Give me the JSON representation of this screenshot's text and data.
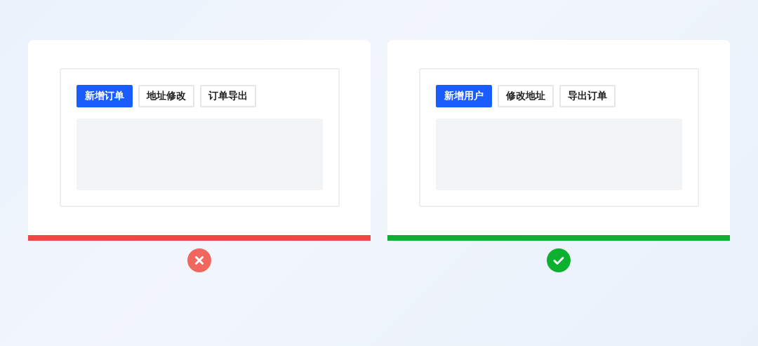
{
  "examples": [
    {
      "kind": "bad",
      "tabs": [
        {
          "label": "新增订单",
          "selected": true
        },
        {
          "label": "地址修改",
          "selected": false
        },
        {
          "label": "订单导出",
          "selected": false
        }
      ]
    },
    {
      "kind": "good",
      "tabs": [
        {
          "label": "新增用户",
          "selected": true
        },
        {
          "label": "修改地址",
          "selected": false
        },
        {
          "label": "导出订单",
          "selected": false
        }
      ]
    }
  ]
}
